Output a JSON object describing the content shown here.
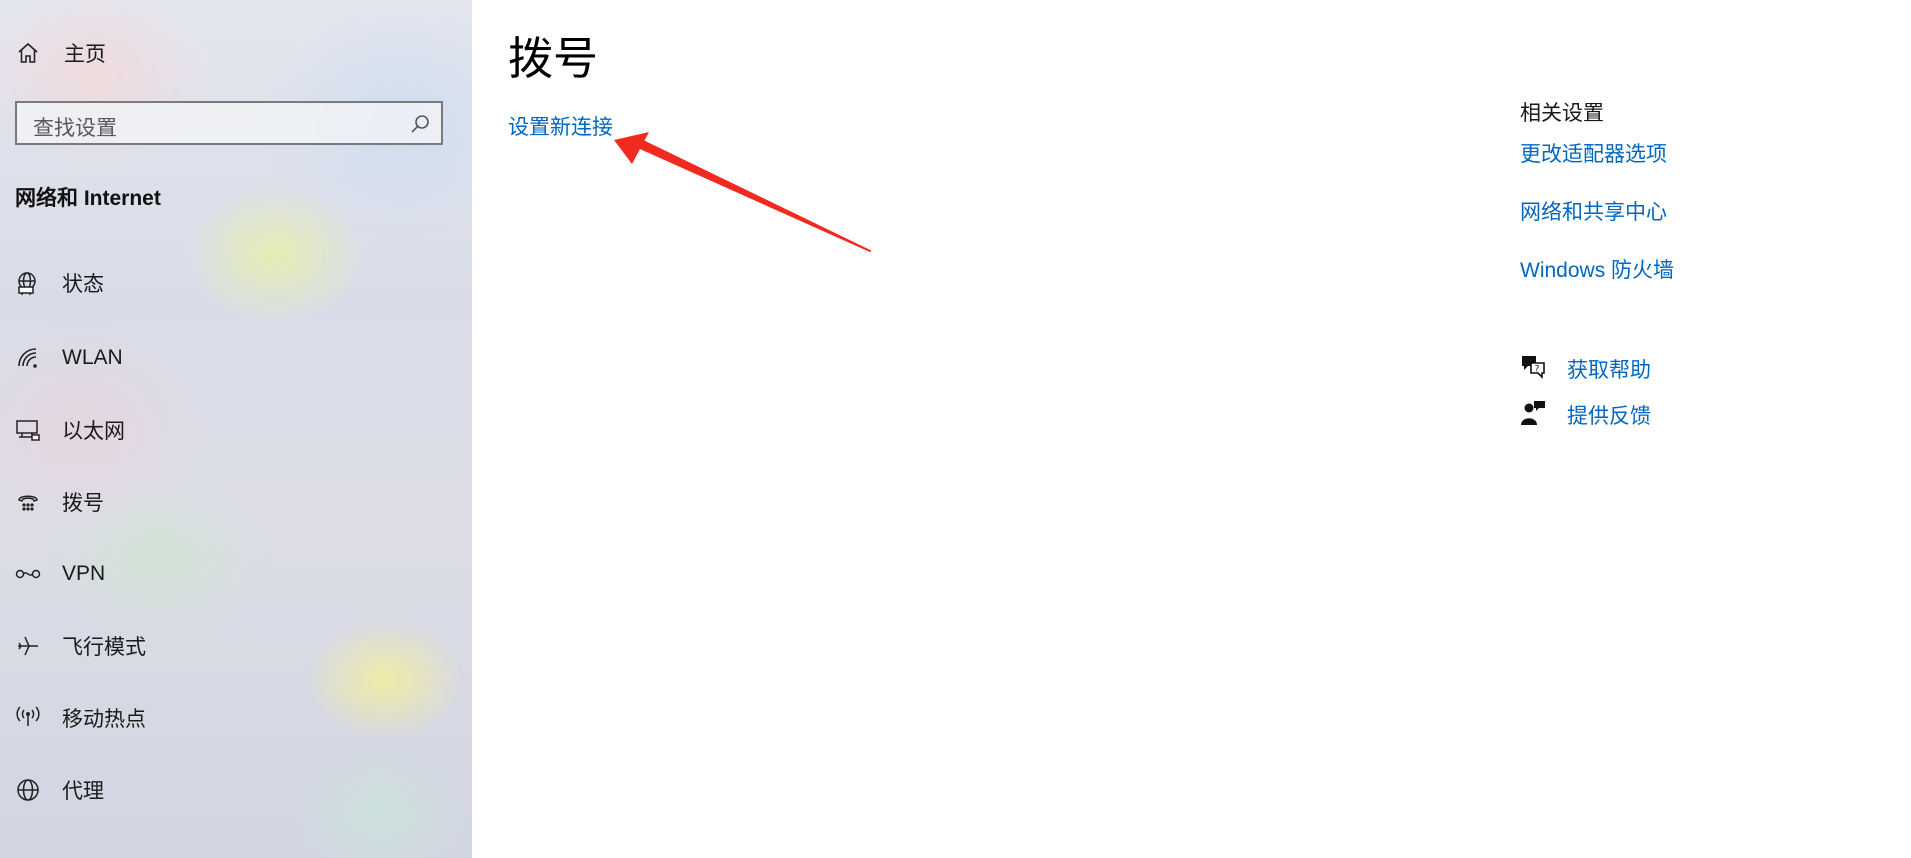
{
  "sidebar": {
    "home_label": "主页",
    "search_placeholder": "查找设置",
    "section_title": "网络和 Internet",
    "items": [
      {
        "label": "状态",
        "icon": "globe-status-icon"
      },
      {
        "label": "WLAN",
        "icon": "wifi-icon"
      },
      {
        "label": "以太网",
        "icon": "ethernet-icon"
      },
      {
        "label": "拨号",
        "icon": "dialup-icon"
      },
      {
        "label": "VPN",
        "icon": "vpn-icon"
      },
      {
        "label": "飞行模式",
        "icon": "airplane-icon"
      },
      {
        "label": "移动热点",
        "icon": "hotspot-icon"
      },
      {
        "label": "代理",
        "icon": "globe-icon"
      }
    ]
  },
  "main": {
    "title": "拨号",
    "setup_link": "设置新连接"
  },
  "related": {
    "title": "相关设置",
    "links": [
      "更改适配器选项",
      "网络和共享中心",
      "Windows 防火墙"
    ]
  },
  "help": {
    "get_help": "获取帮助",
    "feedback": "提供反馈"
  },
  "colors": {
    "link": "#0067c0",
    "annotation_arrow": "#f02a1e"
  }
}
